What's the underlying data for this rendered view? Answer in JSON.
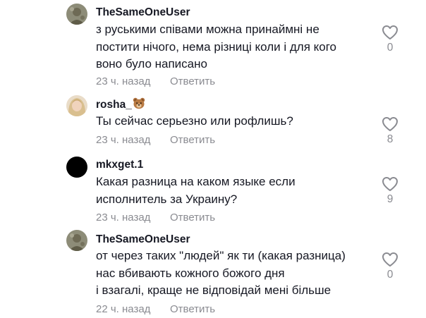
{
  "comments": [
    {
      "username": "TheSameOneUser",
      "avatar": "camouflage-avatar",
      "lines": [
        "з руськими співами можна принаймні не",
        "постити нічого, нема різниці коли і для кого",
        "воно було написано"
      ],
      "time": "23 ч. назад",
      "reply_label": "Ответить",
      "likes": "0"
    },
    {
      "username": "rosha_",
      "username_emoji": "bear-face-icon",
      "avatar": "blonde-avatar",
      "lines": [
        "Ты сейчас серьезно или рофлишь?"
      ],
      "time": "23 ч. назад",
      "reply_label": "Ответить",
      "likes": "8"
    },
    {
      "username": "mkxget.1",
      "avatar": "black-avatar",
      "lines": [
        "Какая разница на каком языке если",
        "исполнитель за Украину?"
      ],
      "time": "23 ч. назад",
      "reply_label": "Ответить",
      "likes": "9"
    },
    {
      "username": "TheSameOneUser",
      "avatar": "camouflage-avatar",
      "lines": [
        "от через таких \"людей\" як ти (какая разница)",
        "нас вбивають кожного божого дня",
        "і взагалі, краще не відповідай мені більше"
      ],
      "time": "22 ч. назад",
      "reply_label": "Ответить",
      "likes": "0"
    }
  ],
  "colors": {
    "text": "#161823",
    "muted": "#8a8b91"
  }
}
